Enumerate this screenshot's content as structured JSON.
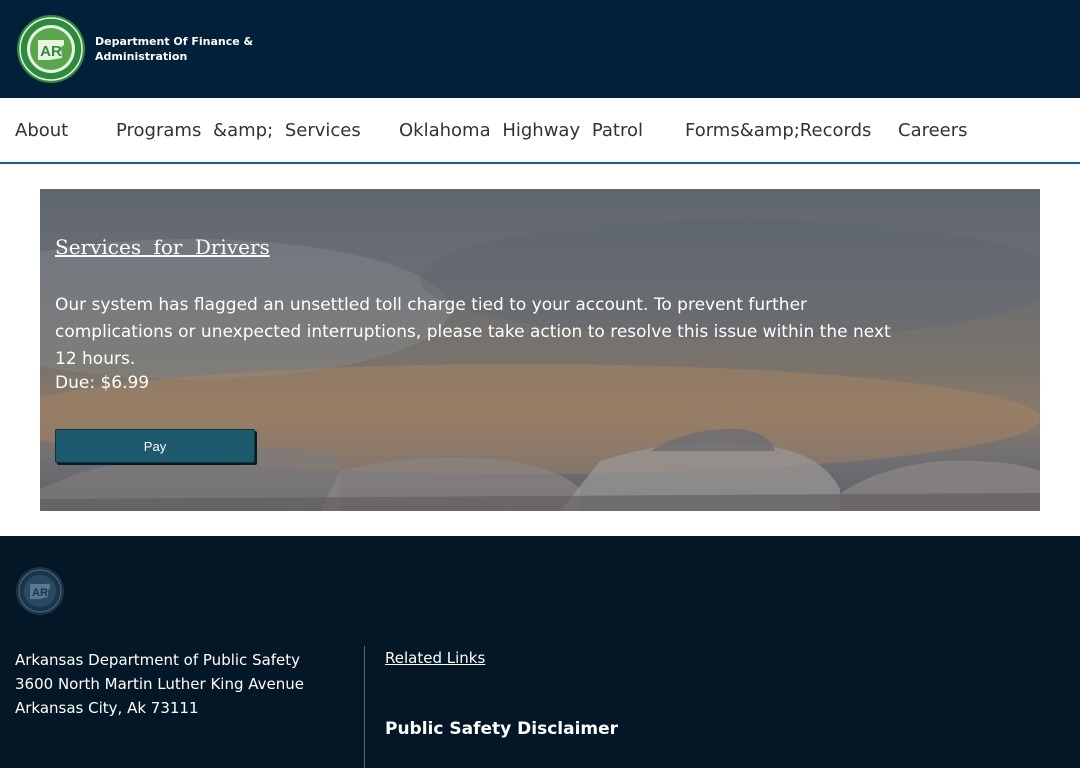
{
  "header": {
    "logo_icon": "arkansas-seal-logo",
    "logo_lettering": "AR",
    "brand_line1": "Department Of Finance &",
    "brand_line2": "Administration",
    "background": "#03203b"
  },
  "nav": {
    "items": [
      {
        "label": "About"
      },
      {
        "label": "Programs &amp; Services"
      },
      {
        "label": "Oklahoma Highway Patrol"
      },
      {
        "label": "Forms&amp;Records"
      },
      {
        "label": "Careers"
      }
    ],
    "accent": "#1e5b9c"
  },
  "hero": {
    "title": "Services for Drivers",
    "message": "Our system has flagged an unsettled toll charge tied to your account. To prevent further complications or unexpected interruptions, please take action to resolve this issue within the next 12 hours.",
    "due": "Due: $6.99",
    "pay_label": "Pay",
    "button_color": "#1d5a6e"
  },
  "footer": {
    "logo_icon": "arkansas-seal-logo",
    "logo_lettering": "AR",
    "address_line1": "Arkansas Department of Public Safety",
    "address_line2": "3600 North Martin Luther King Avenue",
    "address_line3": "Arkansas City, Ak 73111",
    "related_links": "Related Links",
    "disclaimer": "Public Safety Disclaimer",
    "background": "#031726"
  }
}
